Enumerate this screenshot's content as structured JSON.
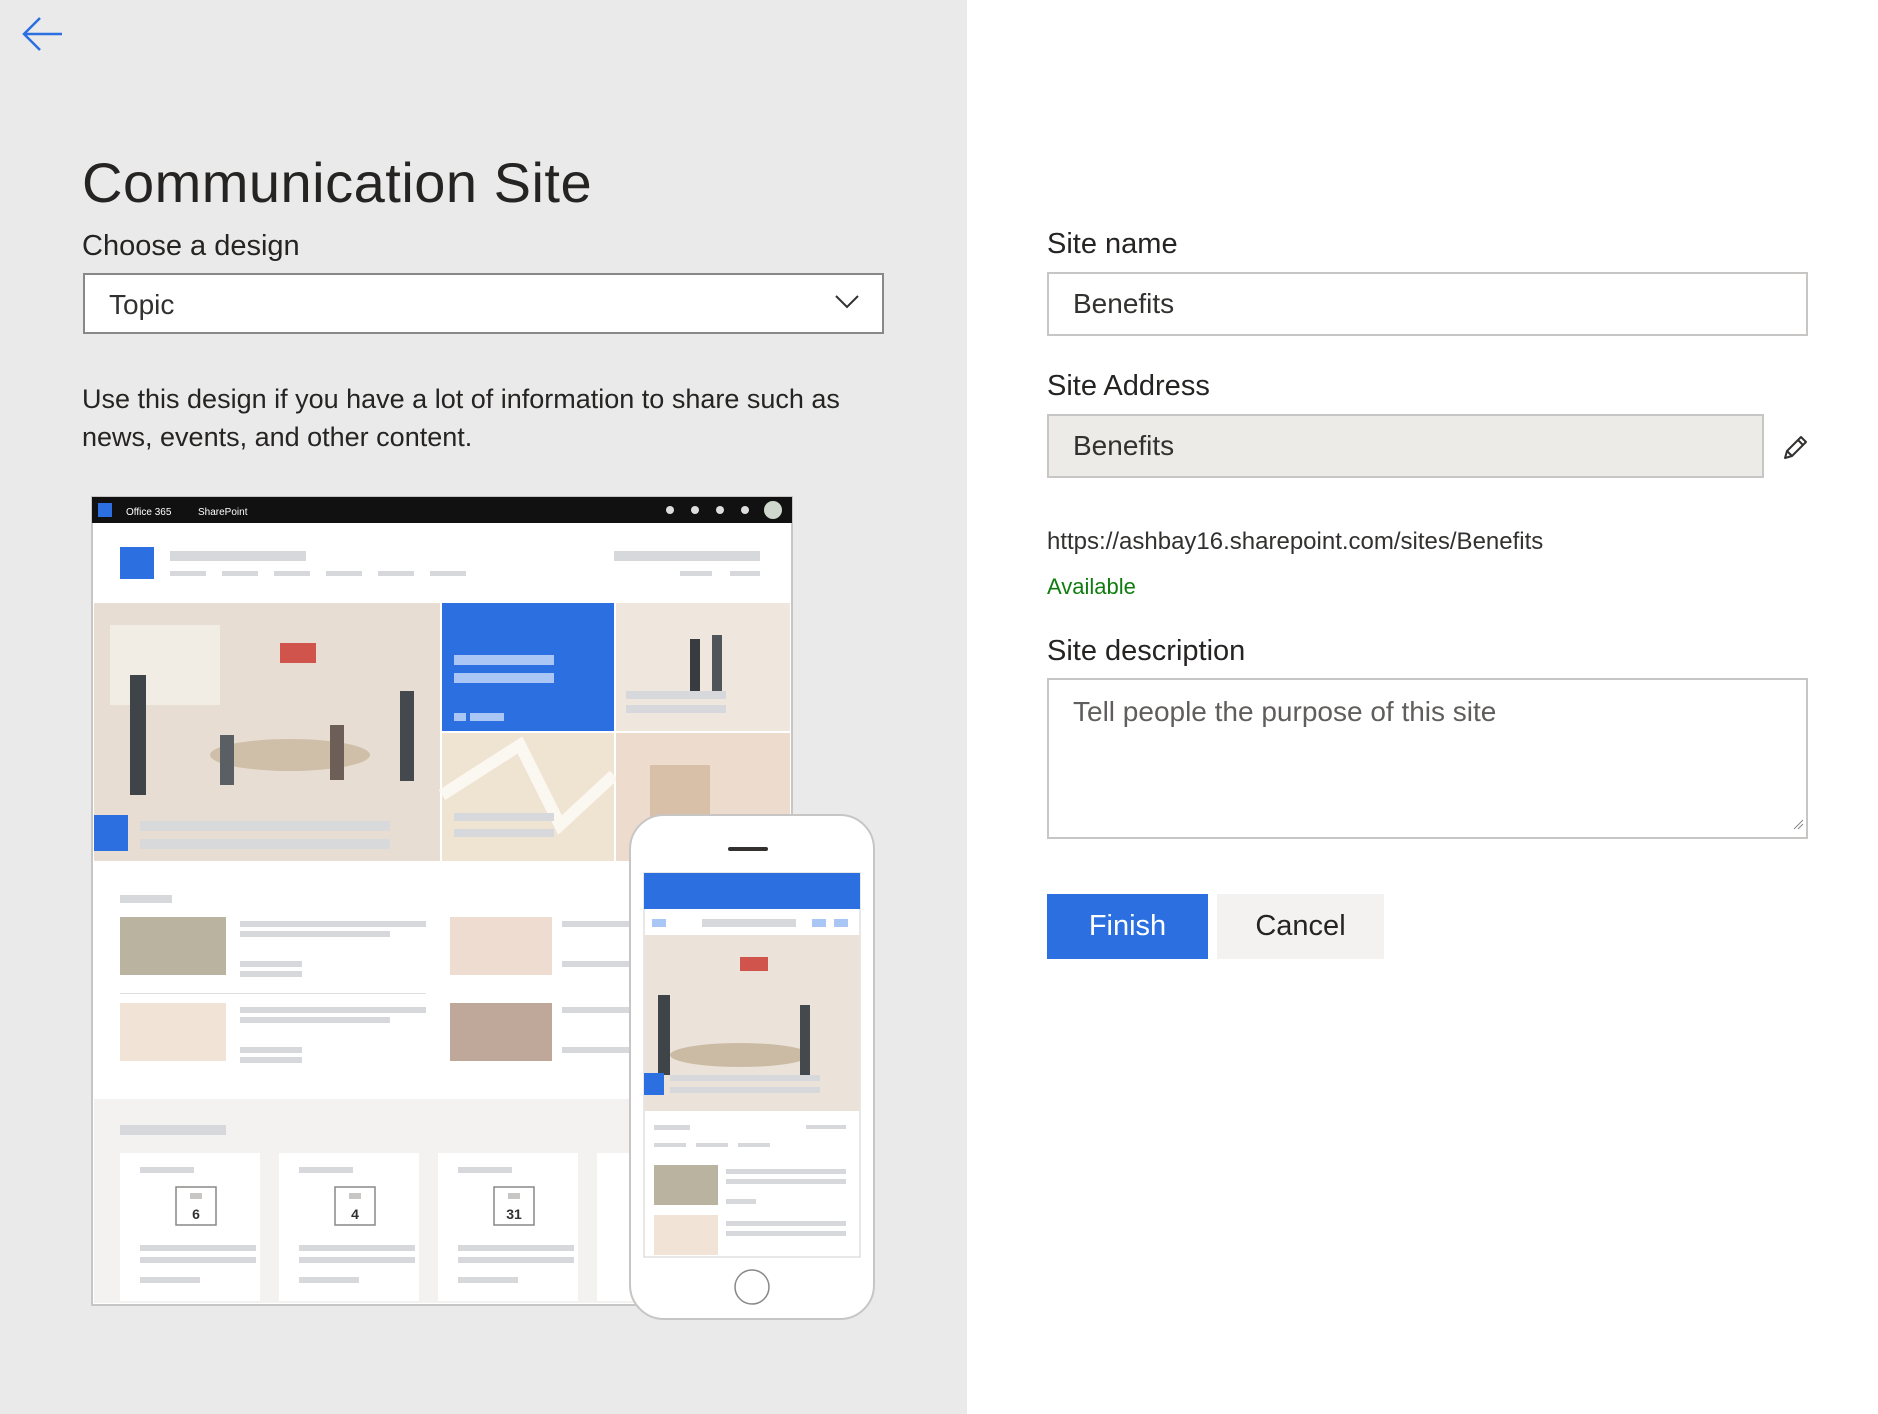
{
  "left_panel": {
    "title": "Communication Site",
    "design_label": "Choose a design",
    "design_selected": "Topic",
    "design_description": "Use this design if you have a lot of information to share such as news, events, and other content.",
    "preview": {
      "topbar_app": "Office 365",
      "topbar_product": "SharePoint",
      "event_days": [
        "6",
        "4",
        "31"
      ]
    }
  },
  "form": {
    "site_name_label": "Site name",
    "site_name_value": "Benefits",
    "site_address_label": "Site Address",
    "site_address_value": "Benefits",
    "site_url": "https://ashbay16.sharepoint.com/sites/Benefits",
    "availability": "Available",
    "site_description_label": "Site description",
    "site_description_placeholder": "Tell people the purpose of this site"
  },
  "buttons": {
    "finish": "Finish",
    "cancel": "Cancel"
  },
  "colors": {
    "left_bg": "#eaeaea",
    "accent": "#2b6fe0",
    "available": "#107c10"
  }
}
